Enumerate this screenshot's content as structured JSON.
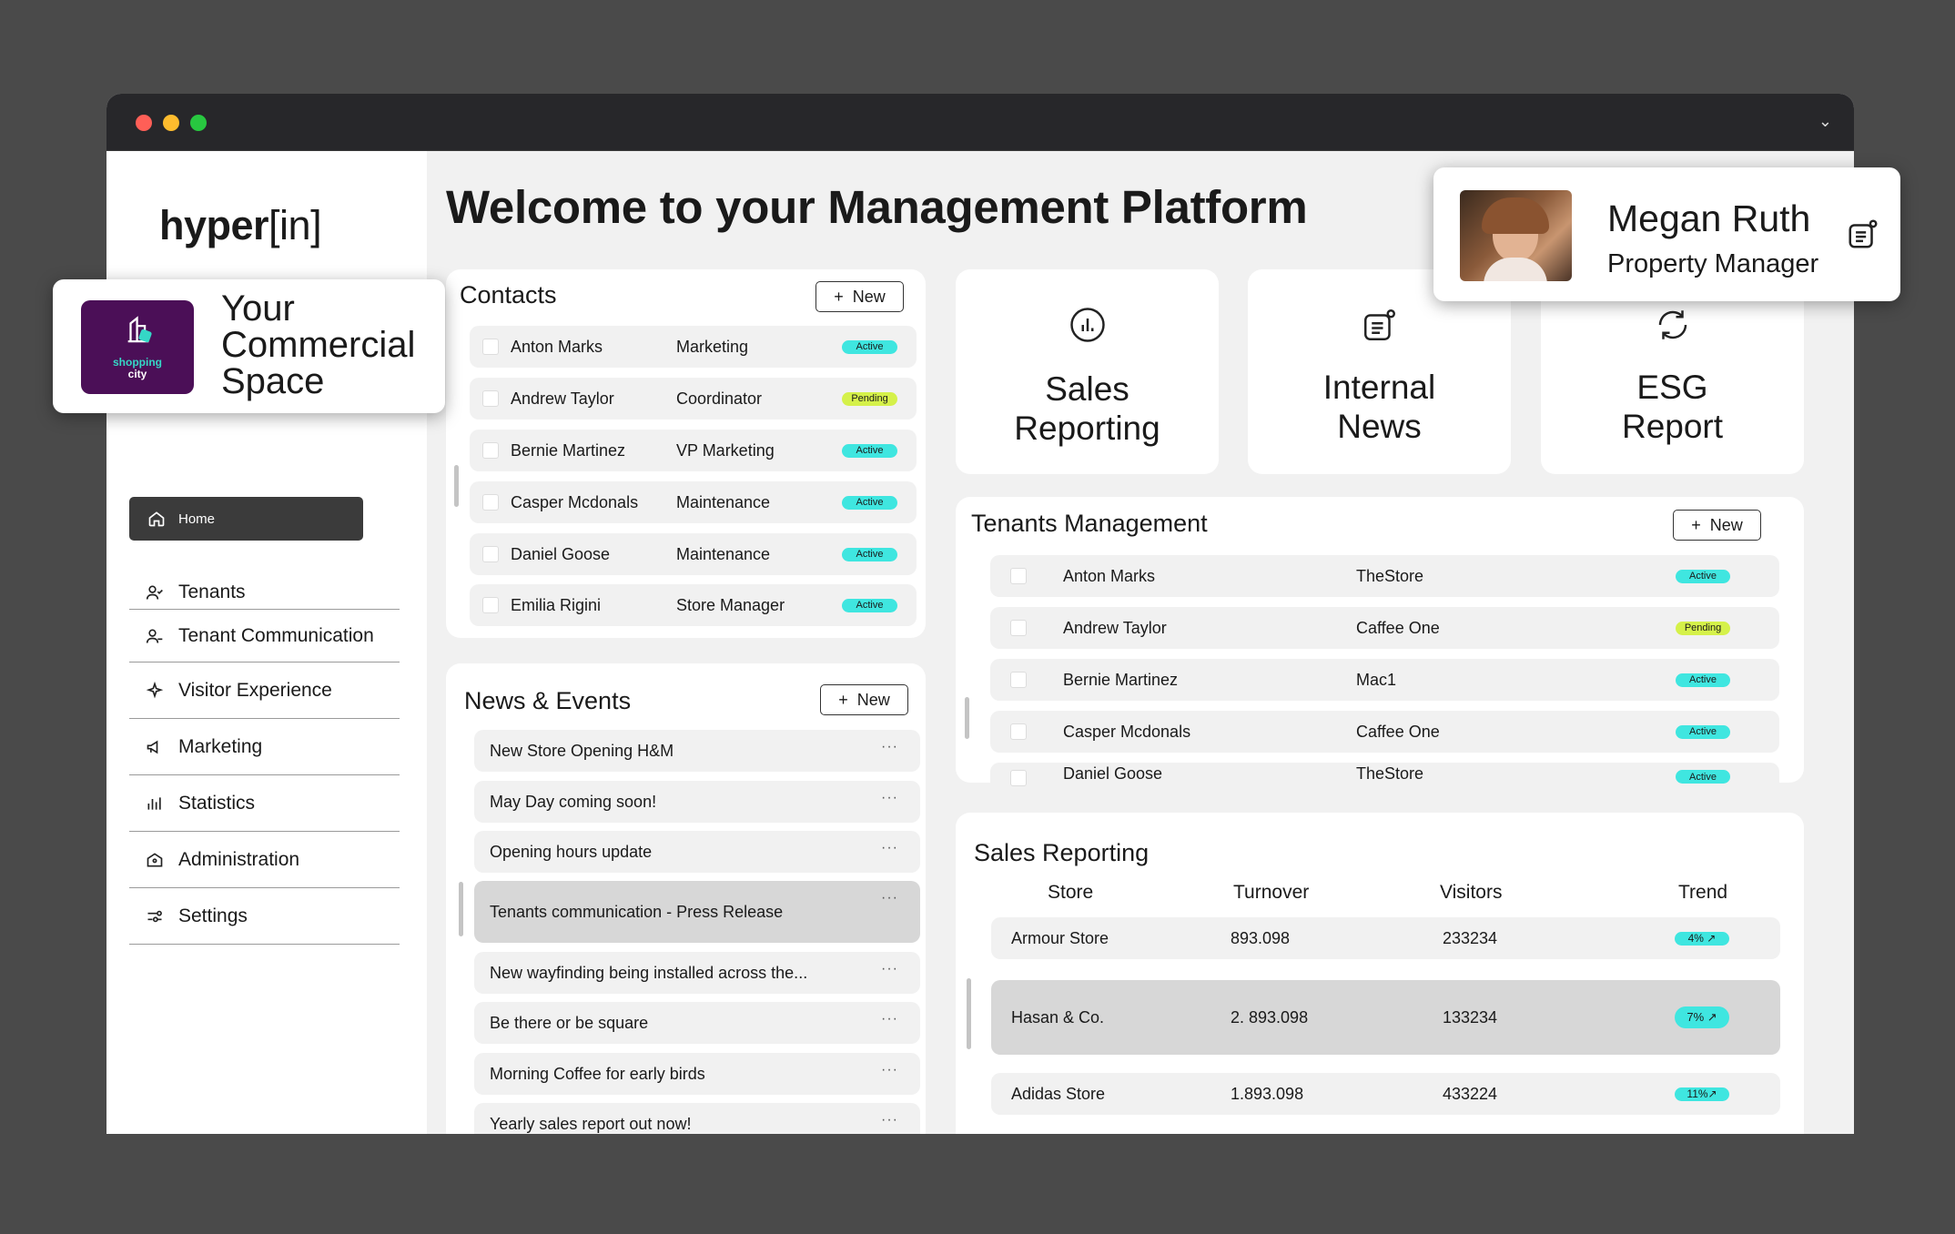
{
  "app": {
    "logo_main": "hyper",
    "logo_bracket": "[in]"
  },
  "brand_card": {
    "logo_line1": "shopping",
    "logo_line2": "city",
    "line1": "Your",
    "line2": "Commercial",
    "line3": "Space",
    "accent": "#4b0f57"
  },
  "profile": {
    "name": "Megan Ruth",
    "role": "Property Manager"
  },
  "nav": {
    "home": "Home",
    "items": [
      {
        "label": "Tenants",
        "icon": "users-icon"
      },
      {
        "label": "Tenant Communication",
        "icon": "users-icon"
      },
      {
        "label": "Visitor Experience",
        "icon": "sparkle-icon"
      },
      {
        "label": "Marketing",
        "icon": "megaphone-icon"
      },
      {
        "label": "Statistics",
        "icon": "bar-chart-icon"
      },
      {
        "label": "Administration",
        "icon": "building-icon"
      },
      {
        "label": "Settings",
        "icon": "sliders-icon"
      }
    ]
  },
  "main": {
    "title": "Welcome to your Management Platform"
  },
  "contacts": {
    "title": "Contacts",
    "new_label": "New",
    "rows": [
      {
        "name": "Anton Marks",
        "role": "Marketing",
        "status": "Active"
      },
      {
        "name": "Andrew Taylor",
        "role": "Coordinator",
        "status": "Pending"
      },
      {
        "name": "Bernie Martinez",
        "role": "VP Marketing",
        "status": "Active"
      },
      {
        "name": "Casper Mcdonals",
        "role": "Maintenance",
        "status": "Active"
      },
      {
        "name": "Daniel Goose",
        "role": "Maintenance",
        "status": "Active"
      },
      {
        "name": "Emilia Rigini",
        "role": "Store Manager",
        "status": "Active"
      }
    ]
  },
  "news": {
    "title": "News & Events",
    "new_label": "New",
    "more": "···",
    "items": [
      "New Store Opening H&M",
      "May Day coming soon!",
      "Opening hours update",
      "Tenants communication - Press Release",
      "New wayfinding being installed across the...",
      "Be there or be square",
      "Morning Coffee for early birds",
      "Yearly sales report out now!"
    ]
  },
  "tiles": [
    {
      "line1": "Sales",
      "line2": "Reporting",
      "icon": "chart-circle-icon"
    },
    {
      "line1": "Internal",
      "line2": "News",
      "icon": "news-icon"
    },
    {
      "line1": "ESG",
      "line2": "Report",
      "icon": "refresh-icon"
    }
  ],
  "tenants": {
    "title": "Tenants Management",
    "new_label": "New",
    "rows": [
      {
        "name": "Anton Marks",
        "store": "TheStore",
        "status": "Active"
      },
      {
        "name": "Andrew Taylor",
        "store": "Caffee One",
        "status": "Pending"
      },
      {
        "name": "Bernie Martinez",
        "store": "Mac1",
        "status": "Active"
      },
      {
        "name": "Casper Mcdonals",
        "store": "Caffee One",
        "status": "Active"
      },
      {
        "name": "Daniel Goose",
        "store": "TheStore",
        "status": "Active"
      }
    ]
  },
  "sales": {
    "title": "Sales Reporting",
    "headers": [
      "Store",
      "Turnover",
      "Visitors",
      "Trend"
    ],
    "rows": [
      {
        "store": "Armour Store",
        "turnover": "893.098",
        "visitors": "233234",
        "trend": "4% ↗"
      },
      {
        "store": "Hasan & Co.",
        "turnover": "2. 893.098",
        "visitors": "133234",
        "trend": "7% ↗"
      },
      {
        "store": "Adidas Store",
        "turnover": "1.893.098",
        "visitors": "433224",
        "trend": "11%↗"
      }
    ]
  },
  "colors": {
    "active": "#3fe6e0",
    "pending": "#d5f14a",
    "dark": "#3b3b3b",
    "selected_row": "#d7d7d7"
  }
}
